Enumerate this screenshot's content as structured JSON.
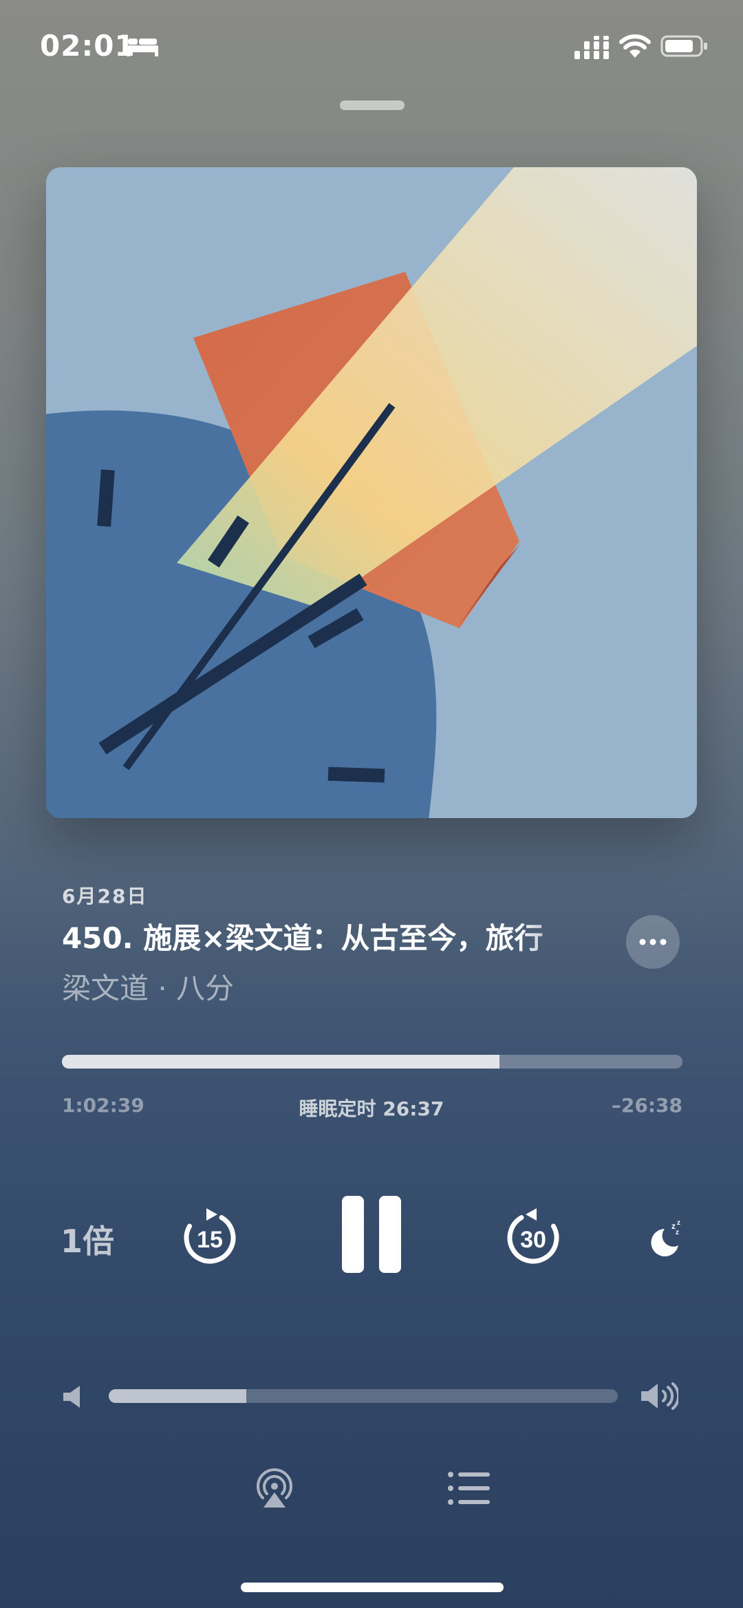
{
  "status_bar": {
    "time": "02:01",
    "icons": [
      "bed-icon",
      "cellular-signal-icon",
      "wifi-icon",
      "battery-icon"
    ]
  },
  "episode": {
    "date": "6月28日",
    "title": "450. 施展×梁文道：从古至今，旅行",
    "author": "梁文道 · 八分"
  },
  "playback": {
    "progress_fraction": 0.705,
    "elapsed": "1:02:39",
    "sleep_timer": "睡眠定时 26:37",
    "remaining": "–26:38"
  },
  "controls": {
    "speed_label": "1倍",
    "skip_back_seconds": "15",
    "skip_forward_seconds": "30",
    "icons": [
      "skip-back-15-icon",
      "pause-icon",
      "skip-forward-30-icon",
      "sleep-timer-icon"
    ]
  },
  "volume": {
    "level_fraction": 0.27
  },
  "bottom": {
    "icons": [
      "airplay-icon",
      "queue-icon"
    ]
  },
  "colors": {
    "artwork_sky": "#98b4cc",
    "artwork_clock": "#4a72a0",
    "artwork_orange": "#d8714f",
    "artwork_beam": "#f3e4b4",
    "artwork_hands": "#1c2f4c"
  }
}
